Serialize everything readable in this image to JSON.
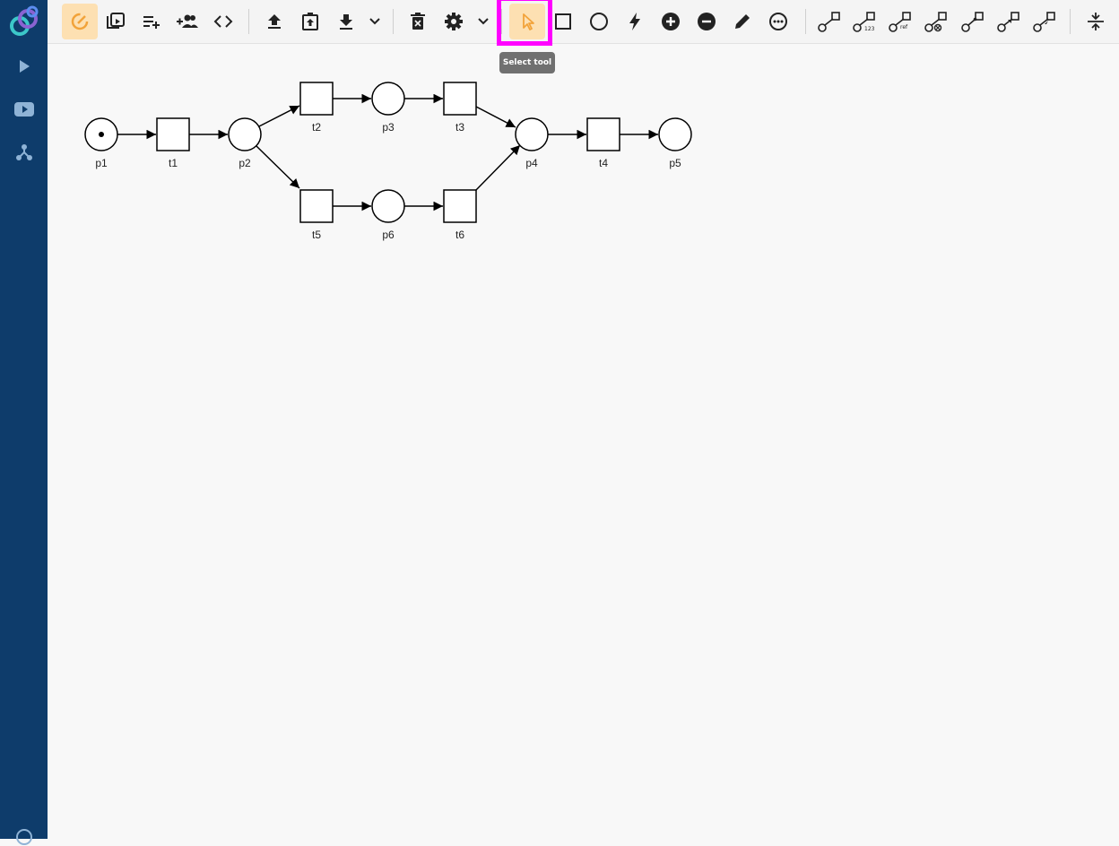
{
  "toolbar": {
    "tooltip": "Select tool"
  },
  "net": {
    "places": [
      "p1",
      "p2",
      "p3",
      "p4",
      "p5",
      "p6"
    ],
    "transitions": [
      "t1",
      "t2",
      "t3",
      "t4",
      "t5",
      "t6"
    ]
  }
}
